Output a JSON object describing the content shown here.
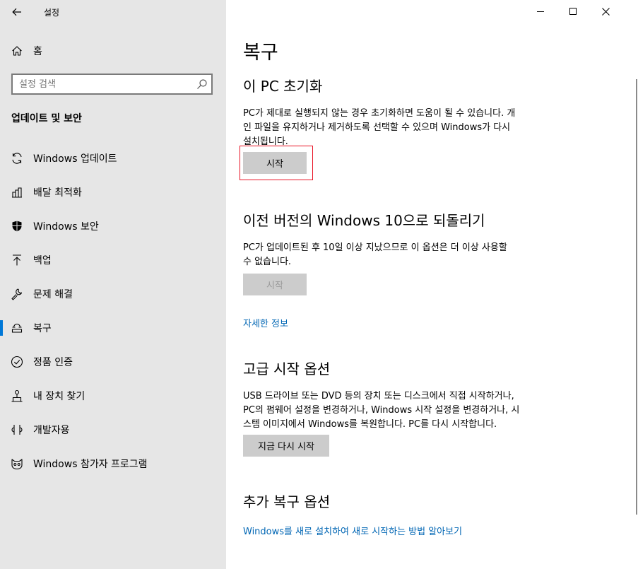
{
  "window": {
    "title": "설정"
  },
  "sidebar": {
    "home_label": "홈",
    "search_placeholder": "설정 검색",
    "section_title": "업데이트 및 보안",
    "items": [
      {
        "label": "Windows 업데이트",
        "icon": "sync-icon"
      },
      {
        "label": "배달 최적화",
        "icon": "delivery-optimization-icon"
      },
      {
        "label": "Windows 보안",
        "icon": "shield-icon"
      },
      {
        "label": "백업",
        "icon": "backup-arrow-icon"
      },
      {
        "label": "문제 해결",
        "icon": "wrench-icon"
      },
      {
        "label": "복구",
        "icon": "recovery-icon",
        "active": true
      },
      {
        "label": "정품 인증",
        "icon": "check-circle-icon"
      },
      {
        "label": "내 장치 찾기",
        "icon": "find-device-icon"
      },
      {
        "label": "개발자용",
        "icon": "developer-icon"
      },
      {
        "label": "Windows 참가자 프로그램",
        "icon": "insider-cat-icon"
      }
    ]
  },
  "main": {
    "page_title": "복구",
    "reset": {
      "heading": "이 PC 초기화",
      "desc_line1": "PC가 제대로 실행되지 않는 경우 초기화하면 도움이 될 수 있습니다. 개",
      "desc_line2": "인 파일을 유지하거나 제거하도록 선택할 수 있으며 Windows가 다시",
      "desc_line3": "설치됩니다.",
      "button": "시작"
    },
    "rollback": {
      "heading": "이전 버전의 Windows 10으로 되돌리기",
      "desc_line1": "PC가 업데이트된 후 10일 이상 지났으므로 이 옵션은 더 이상 사용할",
      "desc_line2": "수 없습니다.",
      "button": "시작",
      "link": "자세한 정보"
    },
    "advanced": {
      "heading": "고급 시작 옵션",
      "desc_line1": "USB 드라이브 또는 DVD 등의 장치 또는 디스크에서 직접 시작하거나,",
      "desc_line2": "PC의 펌웨어 설정을 변경하거나, Windows 시작 설정을 변경하거나, 시",
      "desc_line3": "스템 이미지에서 Windows를 복원합니다. PC를 다시 시작합니다.",
      "button": "지금 다시 시작"
    },
    "more": {
      "heading": "추가 복구 옵션",
      "link": "Windows를 새로 설치하여 새로 시작하는 방법 알아보기"
    }
  },
  "colors": {
    "accent": "#0078d7",
    "link": "#0066b4",
    "sidebar_bg": "#e6e6e6",
    "button_bg": "#cccccc",
    "focus_outline": "#e81123"
  }
}
